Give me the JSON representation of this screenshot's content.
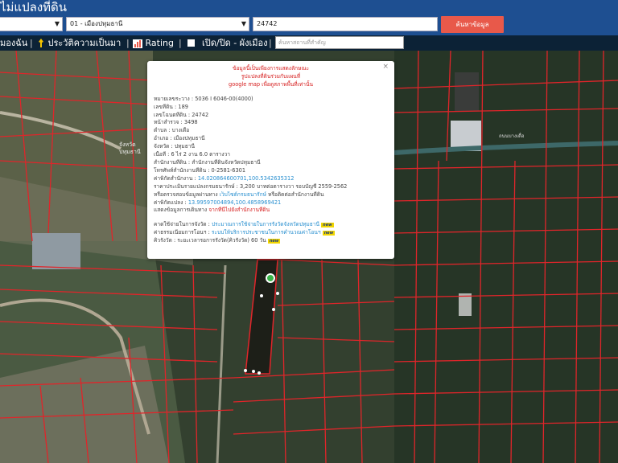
{
  "header": {
    "title": "ไม่แปลงที่ดิน",
    "province_value": "",
    "district_value": "01 - เมืองปทุมธานี",
    "parcel_value": "24742",
    "search_button": "ค้นหาข้อมูล"
  },
  "toolbar": {
    "item1": "มองฉัน",
    "item2": "ประวัติความเป็นมา",
    "item3": "Rating",
    "item4": "เปิด/ปิด - ผังเมือง",
    "place_placeholder": "ค้นหาสถานที่สำคัญ"
  },
  "popup": {
    "close": "×",
    "warning_1": "ข้อมูลนี้เป็นเพียงการแสดงลักษณะ",
    "warning_2": "รูปแปลงที่ดินร่วมกับแผนที่",
    "warning_3": "google map เพื่อดูสภาพพื้นที่เท่านั้น",
    "map_sheet_label": "หมายเลขระวาง",
    "map_sheet_value": "5036 I 6046-00(4000)",
    "land_no_label": "เลขที่ดิน",
    "land_no_value": "189",
    "deed_no_label": "เลขโฉนดที่ดิน",
    "deed_no_value": "24742",
    "survey_page_label": "หน้าสำรวจ",
    "survey_page_value": "3498",
    "tambon_label": "ตำบล",
    "tambon_value": "บางเดื่อ",
    "amphoe_label": "อำเภอ",
    "amphoe_value": "เมืองปทุมธานี",
    "province_label": "จังหวัด",
    "province_value": "ปทุมธานี",
    "area_label": "เนื้อที่",
    "area_value": "6 ไร่ 2 งาน 6.0 ตารางวา",
    "office_label": "สำนักงานที่ดิน",
    "office_value": "สำนักงานที่ดินจังหวัดปทุมธานี",
    "phone_label": "โทรศัพท์สำนักงานที่ดิน",
    "phone_value": "0-2581-6301",
    "coords_label": "ค่าพิกัดสำนักงาน",
    "coords_value": "14.020864600701,100.5342635312",
    "appraisal_label": "ราคาประเมินรายแปลงกรมธนารักษ์",
    "appraisal_value": "3,200 บาทต่อตารางวา รอบบัญชี 2559-2562",
    "appraisal_check_prefix": "หรือตรวจสอบข้อมูลผ่านทาง",
    "appraisal_check_link": "เว็บไซต์กรมธนารักษ์",
    "appraisal_check_suffix": "หรือติดต่อสำนักงานที่ดิน",
    "parcel_coords_label": "ค่าพิกัดแปลง",
    "parcel_coords_value": "13.99597004894,100.4858969421",
    "route_label": "แสดงข้อมูลการเดินทาง",
    "route_link": "จากที่นี่ไปยังสำนักงานที่ดิน",
    "queue_label": "คาดใช้จ่ายในการจังวัด",
    "queue_link": "ประมาณการใช้จ่ายในการรังวัดจังหวัดปทุมธานี",
    "queue_badge": "new",
    "fee_label": "ค่าธรรมเนียมการโอนฯ",
    "fee_link": "ระบบให้บริการประชาชนในการคำนวณค่าโอนฯ",
    "fee_badge": "new",
    "survey_queue_label": "คิวรังวัด",
    "survey_queue_value": "ระยะเวลารอการรังวัด(คิวรังวัด) 60 วัน",
    "survey_queue_badge": "new"
  },
  "map": {
    "label_1": "จังหวัด",
    "label_2": "ปทุมธานี",
    "label_3": "ถนนบางเดื่อ"
  },
  "colors": {
    "header": "#1e4f91",
    "toolbar": "#0c2236",
    "button": "#e8594a",
    "parcel_lines": "#e0252a",
    "link": "#2a90d0",
    "warning": "#d62020"
  }
}
